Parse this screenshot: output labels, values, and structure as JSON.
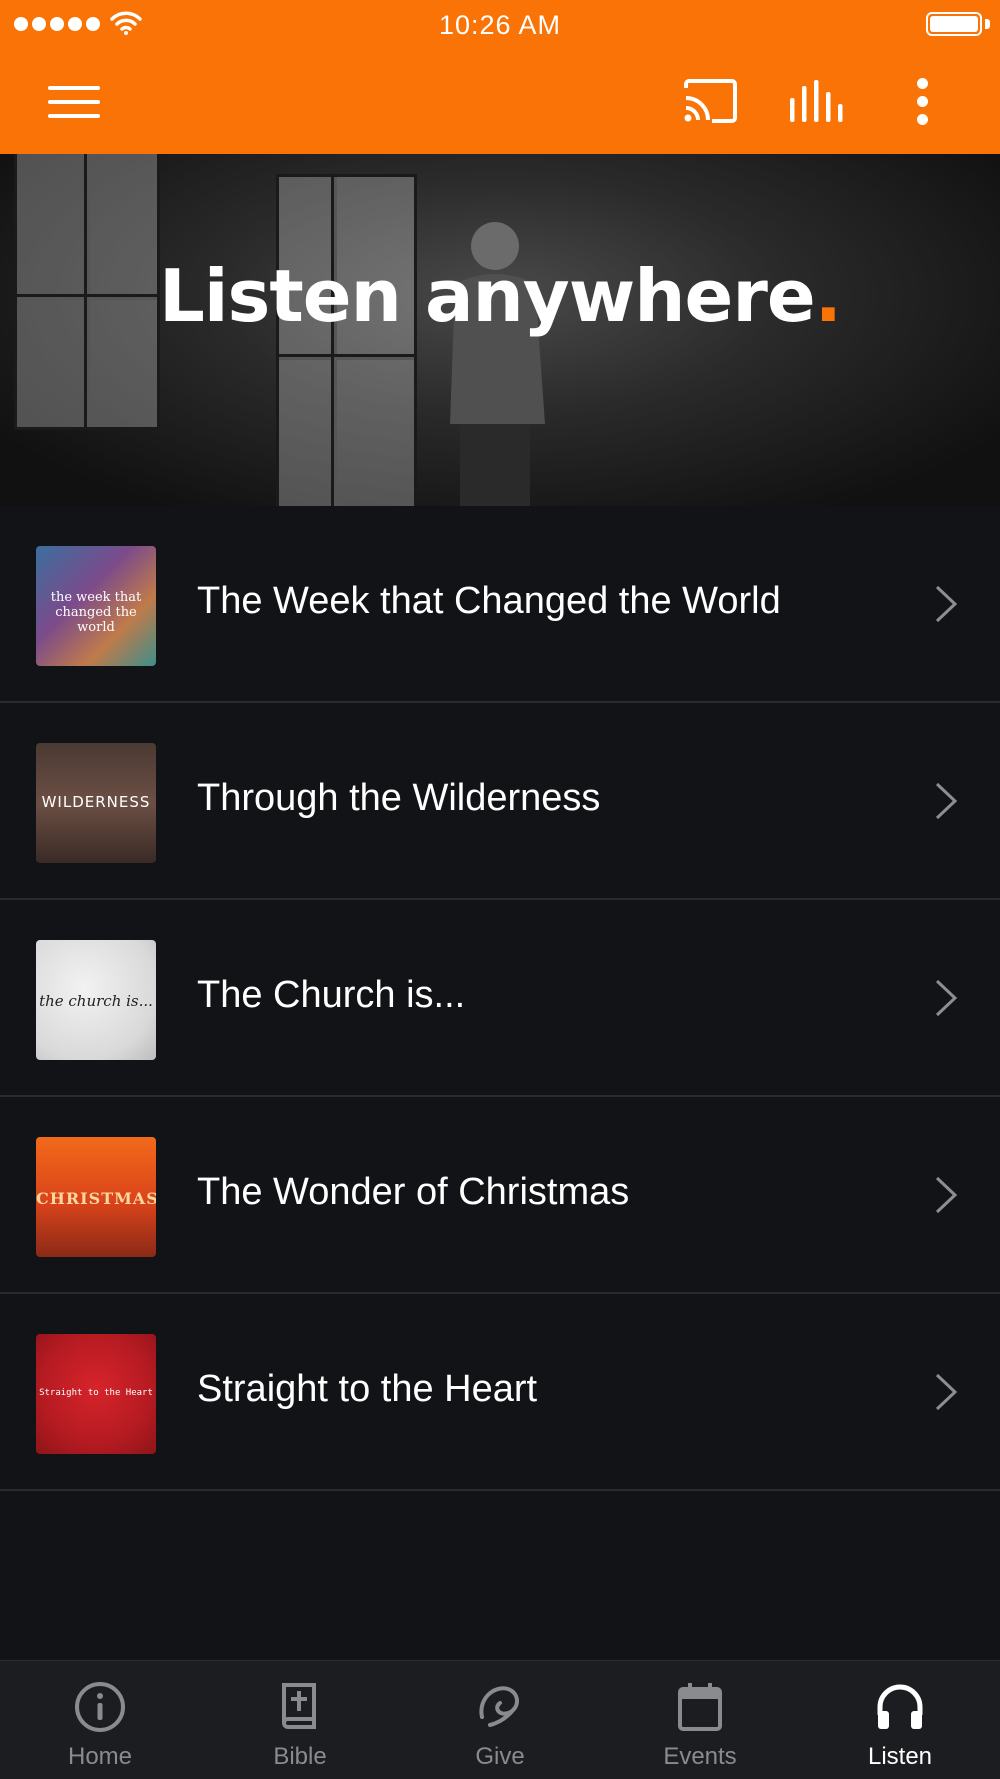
{
  "status_bar": {
    "time": "10:26 AM"
  },
  "hero": {
    "title": "Listen anywhere",
    "title_accent": "."
  },
  "series": [
    {
      "label": "The Week that Changed the World",
      "thumb_text": "the week that changed the world"
    },
    {
      "label": "Through the Wilderness",
      "thumb_text": "WILDERNESS"
    },
    {
      "label": "The Church is...",
      "thumb_text": "the church is..."
    },
    {
      "label": "The Wonder of Christmas",
      "thumb_text": "CHRISTMAS"
    },
    {
      "label": "Straight to the Heart",
      "thumb_text": "Straight to the Heart"
    }
  ],
  "tabs": [
    {
      "label": "Home",
      "icon": "info-icon"
    },
    {
      "label": "Bible",
      "icon": "bible-icon"
    },
    {
      "label": "Give",
      "icon": "give-icon"
    },
    {
      "label": "Events",
      "icon": "calendar-icon"
    },
    {
      "label": "Listen",
      "icon": "headphones-icon",
      "active": true
    }
  ],
  "colors": {
    "accent": "#f97306",
    "background": "#121316",
    "tabbar": "#1c1d20"
  }
}
